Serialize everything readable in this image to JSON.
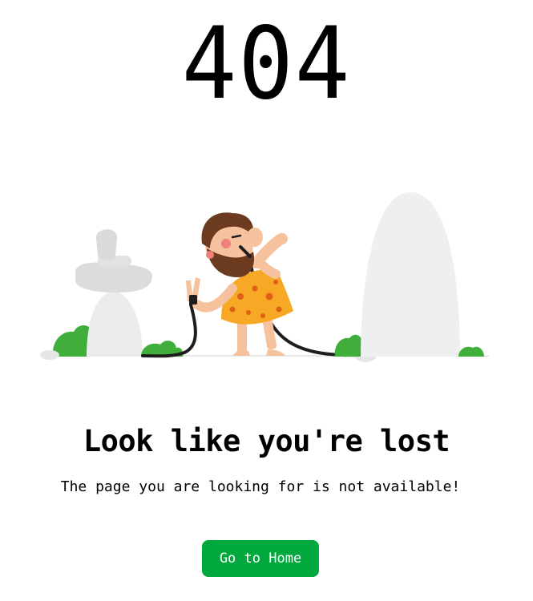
{
  "error": {
    "code": "404"
  },
  "message": {
    "headline": "Look like you're lost",
    "subtext": "The page you are looking for is not available!"
  },
  "actions": {
    "home_label": "Go to Home"
  },
  "colors": {
    "button": "#00a83e",
    "rock": "#e8e8e8",
    "bush": "#3fae3a",
    "tunic": "#f7a825",
    "skin": "#f6c29e",
    "hair": "#6b3a1f"
  },
  "illustration": {
    "icons": [
      "stacked-stones-icon",
      "bush-icon",
      "caveman-icon",
      "cable-icon",
      "tall-rock-icon"
    ]
  }
}
